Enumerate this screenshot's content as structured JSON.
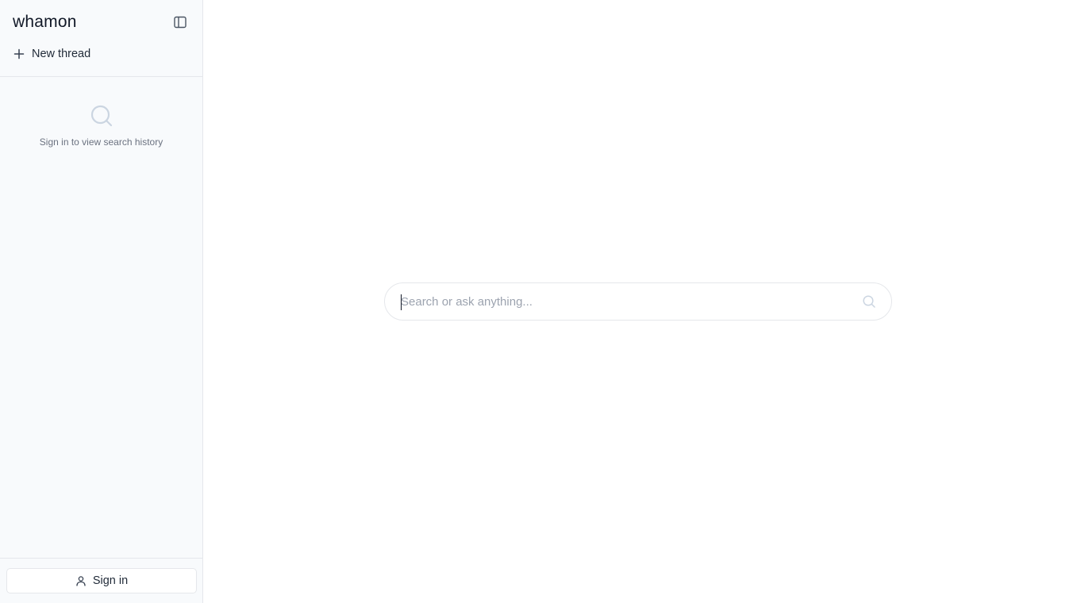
{
  "sidebar": {
    "brand": "whamon",
    "toggle_icon": "sidebar-toggle-icon",
    "new_thread": {
      "label": "New thread",
      "icon": "plus-icon"
    },
    "history_empty": {
      "icon": "search-icon",
      "text": "Sign in to view search history"
    },
    "sign_in": {
      "label": "Sign in",
      "icon": "user-icon"
    }
  },
  "main": {
    "search": {
      "placeholder": "Search or ask anything...",
      "value": "",
      "icon": "search-icon"
    }
  },
  "colors": {
    "sidebar_bg": "#f8fafc",
    "border": "#e5e7eb",
    "muted_text": "#6b7280",
    "placeholder": "#9ca3af"
  }
}
